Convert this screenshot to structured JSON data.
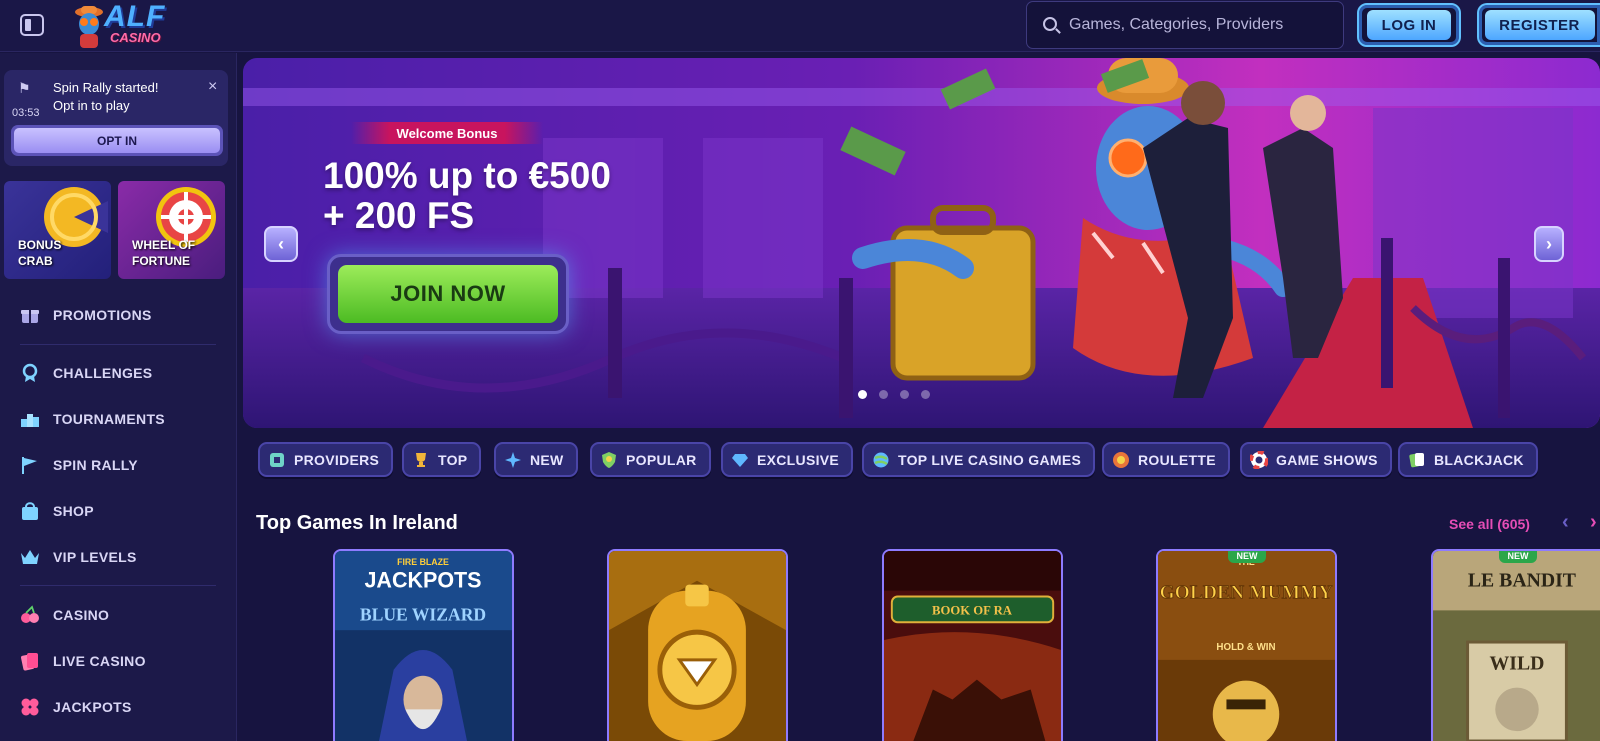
{
  "header": {
    "logo_main": "ALF",
    "logo_sub": "CASINO",
    "search_placeholder": "Games, Categories, Providers",
    "login_label": "LOG IN",
    "register_label": "REGISTER"
  },
  "sidebar": {
    "rally": {
      "line1": "Spin Rally started!",
      "line2": "Opt in to play",
      "timer": "03:53",
      "optin_label": "OPT IN"
    },
    "features": [
      {
        "label": "BONUS\nCRAB"
      },
      {
        "label": "WHEEL OF\nFORTUNE"
      }
    ],
    "nav": [
      {
        "label": "PROMOTIONS",
        "icon": "gift-icon"
      },
      {
        "label": "CHALLENGES",
        "icon": "medal-icon"
      },
      {
        "label": "TOURNAMENTS",
        "icon": "podium-icon"
      },
      {
        "label": "SPIN RALLY",
        "icon": "flag-icon"
      },
      {
        "label": "SHOP",
        "icon": "shopping-bag-icon"
      },
      {
        "label": "VIP LEVELS",
        "icon": "crown-icon"
      },
      {
        "label": "CASINO",
        "icon": "cherries-icon"
      },
      {
        "label": "LIVE CASINO",
        "icon": "playing-cards-icon"
      },
      {
        "label": "JACKPOTS",
        "icon": "clover-icon"
      }
    ]
  },
  "hero": {
    "badge": "Welcome Bonus",
    "line1": "100% up to €500",
    "line2": "+ 200 FS",
    "cta": "JOIN NOW",
    "slide_count": 4,
    "active_slide": 1
  },
  "categories": [
    {
      "label": "PROVIDERS",
      "icon": "providers-icon"
    },
    {
      "label": "TOP",
      "icon": "trophy-icon"
    },
    {
      "label": "NEW",
      "icon": "sparkle-icon"
    },
    {
      "label": "POPULAR",
      "icon": "shield-star-icon"
    },
    {
      "label": "EXCLUSIVE",
      "icon": "diamond-icon"
    },
    {
      "label": "TOP LIVE CASINO GAMES",
      "icon": "globe-icon"
    },
    {
      "label": "ROULETTE",
      "icon": "roulette-icon"
    },
    {
      "label": "GAME SHOWS",
      "icon": "lifebuoy-icon"
    },
    {
      "label": "BLACKJACK",
      "icon": "cards-icon"
    }
  ],
  "games_section": {
    "title": "Top Games In Ireland",
    "see_all": "See all (605)",
    "games": [
      {
        "name": "Fire Blaze Jackpots Blue Wizard",
        "art_title_1": "FIRE BLAZE",
        "art_title_2": "JACKPOTS",
        "art_title_3": "BLUE WIZARD",
        "is_new": false
      },
      {
        "name": "Golden train game",
        "art_title_1": "",
        "art_title_2": "",
        "art_title_3": "",
        "is_new": false
      },
      {
        "name": "Book of Ra",
        "art_title_1": "BOOK OF RA",
        "art_title_2": "",
        "art_title_3": "",
        "is_new": false
      },
      {
        "name": "The Golden Mummy Hold & Win",
        "art_title_1": "THE",
        "art_title_2": "GOLDEN MUMMY",
        "art_title_3": "HOLD & WIN",
        "is_new": true
      },
      {
        "name": "Le Bandit",
        "art_title_1": "LE BANDIT",
        "art_title_2": "WILD",
        "art_title_3": "",
        "is_new": true
      }
    ],
    "new_badge": "NEW"
  },
  "colors": {
    "background": "#171440",
    "accent_blue": "#61c0ff",
    "accent_pink": "#e64db6",
    "cta_green": "#4cbb23"
  }
}
